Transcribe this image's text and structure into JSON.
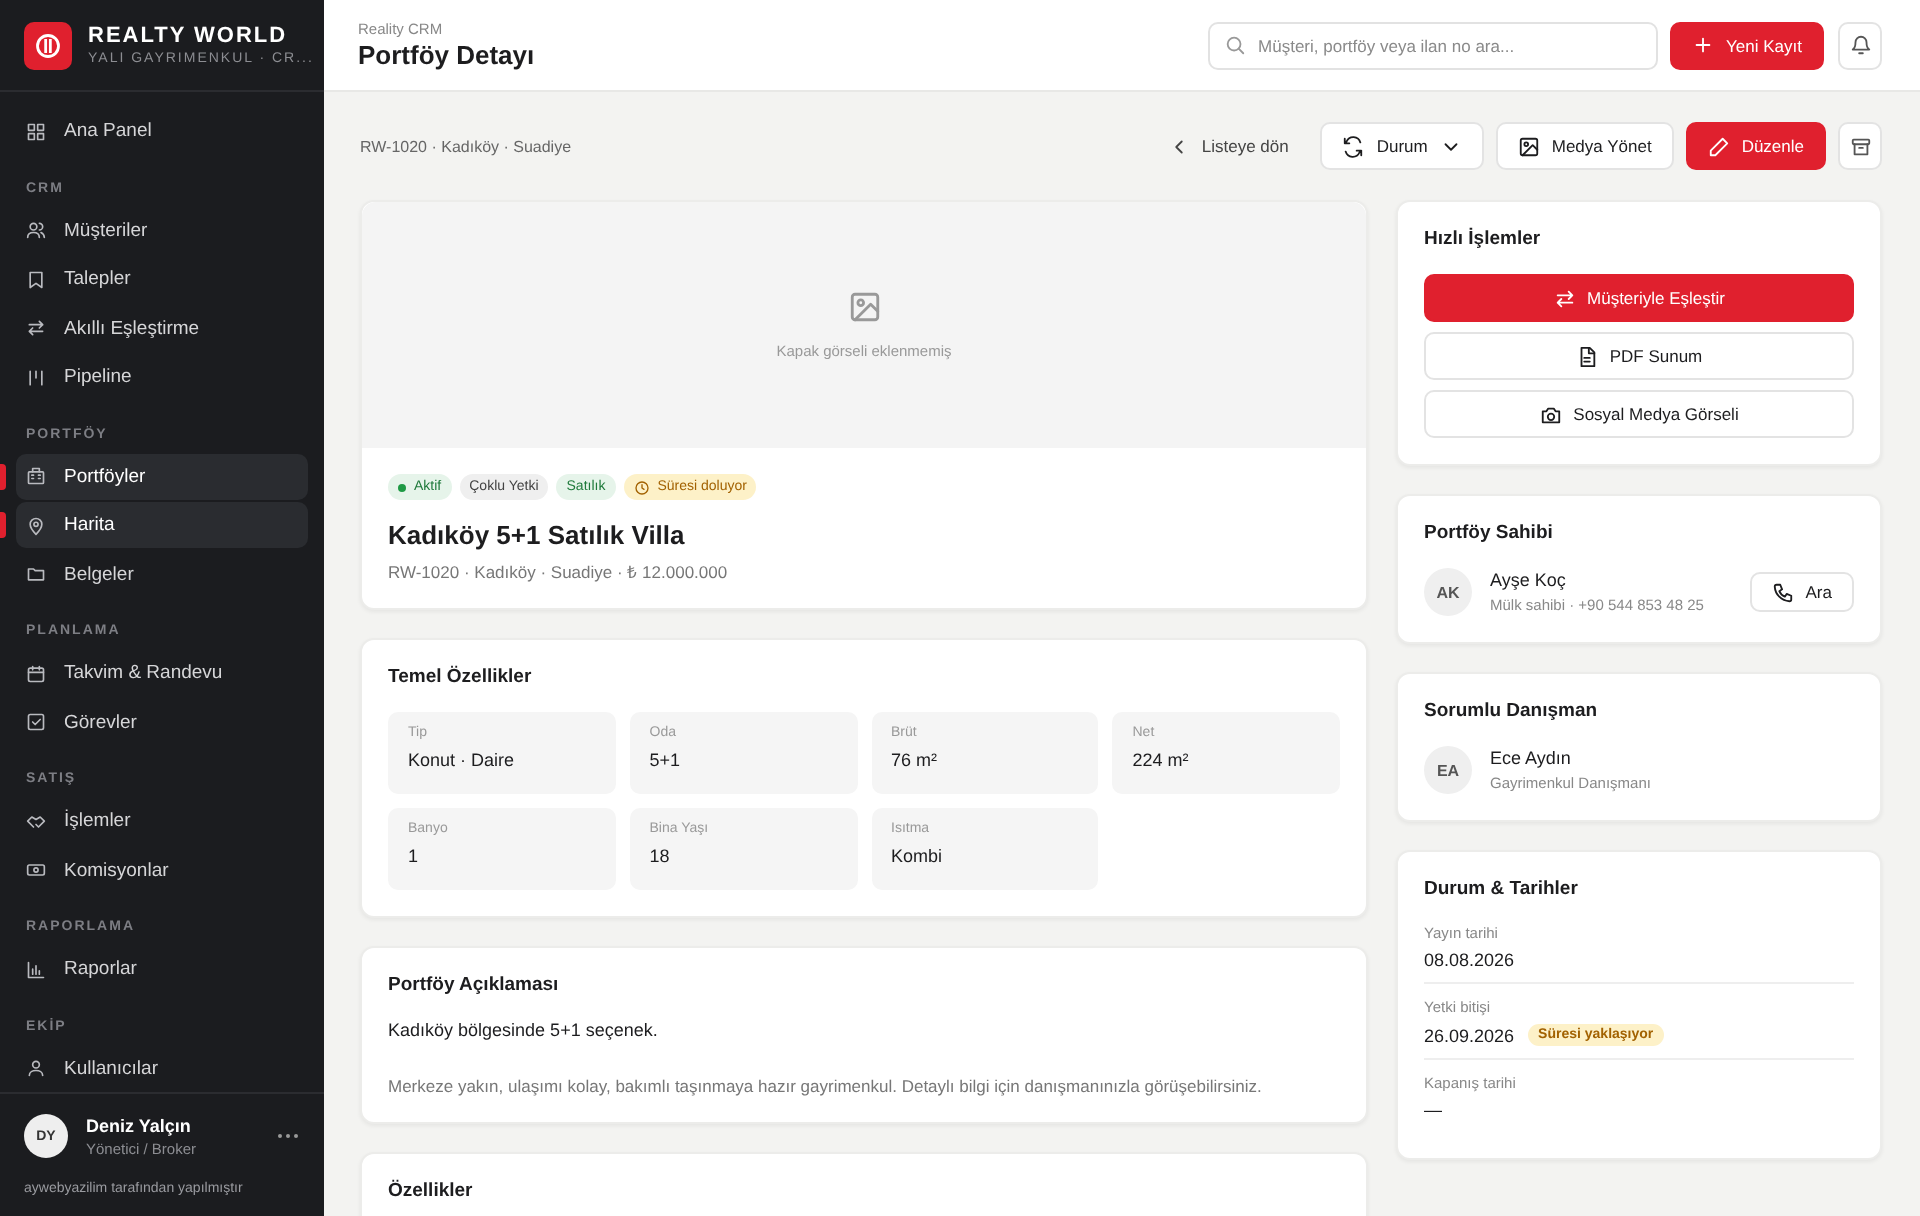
{
  "sidebar": {
    "brand": {
      "name": "REALTY WORLD",
      "subtitle": "YALI GAYRIMENKUL · CR..."
    },
    "sections": [
      {
        "items": [
          {
            "label": "Ana Panel",
            "selected": false
          }
        ]
      },
      {
        "title": "CRM",
        "items": [
          {
            "label": "Müşteriler",
            "selected": false
          },
          {
            "label": "Talepler",
            "selected": false
          },
          {
            "label": "Akıllı Eşleştirme",
            "selected": false
          },
          {
            "label": "Pipeline",
            "selected": false
          }
        ]
      },
      {
        "title": "PORTFÖY",
        "items": [
          {
            "label": "Portföyler",
            "selected": true
          },
          {
            "label": "Harita",
            "selected": true
          },
          {
            "label": "Belgeler",
            "selected": false
          }
        ]
      },
      {
        "title": "PLANLAMA",
        "items": [
          {
            "label": "Takvim & Randevu",
            "selected": false
          },
          {
            "label": "Görevler",
            "selected": false
          }
        ]
      },
      {
        "title": "SATIŞ",
        "items": [
          {
            "label": "İşlemler",
            "selected": false
          },
          {
            "label": "Komisyonlar",
            "selected": false
          }
        ]
      },
      {
        "title": "RAPORLAMA",
        "items": [
          {
            "label": "Raporlar",
            "selected": false
          }
        ]
      },
      {
        "title": "EKİP",
        "items": [
          {
            "label": "Kullanıcılar",
            "selected": false
          }
        ]
      }
    ],
    "user": {
      "initials": "DY",
      "name": "Deniz Yalçın",
      "role": "Yönetici / Broker"
    },
    "footer": "aywebyazilim tarafından yapılmıştır"
  },
  "header": {
    "app": "Reality CRM",
    "title": "Portföy Detayı",
    "search": {
      "placeholder": "Müşteri, portföy veya ilan no ara..."
    },
    "new_button": "Yeni Kayıt"
  },
  "toolbar": {
    "breadcrumb": "RW-1020 · Kadıköy · Suadiye",
    "back": "Listeye dön",
    "buttons": [
      {
        "label": "Durum",
        "kind": "dropdown"
      },
      {
        "label": "Medya Yönet",
        "kind": "media"
      },
      {
        "label": "Düzenle",
        "kind": "primary"
      }
    ]
  },
  "listing": {
    "cover_text": "Kapak görseli eklenmemiş",
    "tags": [
      {
        "label": "Aktif",
        "kind": "status"
      },
      {
        "label": "Çoklu Yetki",
        "kind": "neutral"
      },
      {
        "label": "Satılık",
        "kind": "green"
      },
      {
        "label": "Süresi doluyor",
        "kind": "warning"
      }
    ],
    "title": "Kadıköy 5+1 Satılık Villa",
    "subtitle": "RW-1020 · Kadıköy · Suadiye · ₺ 12.000.000"
  },
  "features": {
    "title": "Temel Özellikler",
    "items": [
      {
        "label": "Tip",
        "value": "Konut · Daire"
      },
      {
        "label": "Oda",
        "value": "5+1"
      },
      {
        "label": "Brüt",
        "value": "76 m²"
      },
      {
        "label": "Net",
        "value": "224 m²"
      },
      {
        "label": "Banyo",
        "value": "1"
      },
      {
        "label": "Bina Yaşı",
        "value": "18"
      },
      {
        "label": "Isıtma",
        "value": "Kombi"
      }
    ]
  },
  "description": {
    "title": "Portföy Açıklaması",
    "lead": "Kadıköy bölgesinde 5+1 seçenek.",
    "body": "Merkeze yakın, ulaşımı kolay, bakımlı taşınmaya hazır gayrimenkul. Detaylı bilgi için danışmanınızla görüşebilirsiniz."
  },
  "extras": {
    "title": "Özellikler"
  },
  "quick_actions": {
    "title": "Hızlı İşlemler",
    "buttons": [
      {
        "label": "Müşteriyle Eşleştir",
        "kind": "primary"
      },
      {
        "label": "PDF Sunum",
        "kind": "pdf"
      },
      {
        "label": "Sosyal Medya Görseli",
        "kind": "camera"
      }
    ]
  },
  "owner": {
    "title": "Portföy Sahibi",
    "initials": "AK",
    "name": "Ayşe Koç",
    "detail": "Mülk sahibi · +90 544 853 48 25",
    "call": "Ara"
  },
  "agent": {
    "title": "Sorumlu Danışman",
    "initials": "EA",
    "name": "Ece Aydın",
    "detail": "Gayrimenkul Danışmanı"
  },
  "dates": {
    "title": "Durum & Tarihler",
    "items": [
      {
        "label": "Yayın tarihi",
        "value": "08.08.2026"
      },
      {
        "label": "Yetki bitişi",
        "value": "26.09.2026",
        "badge": "Süresi yaklaşıyor"
      },
      {
        "label": "Kapanış tarihi",
        "value": "—"
      }
    ]
  }
}
